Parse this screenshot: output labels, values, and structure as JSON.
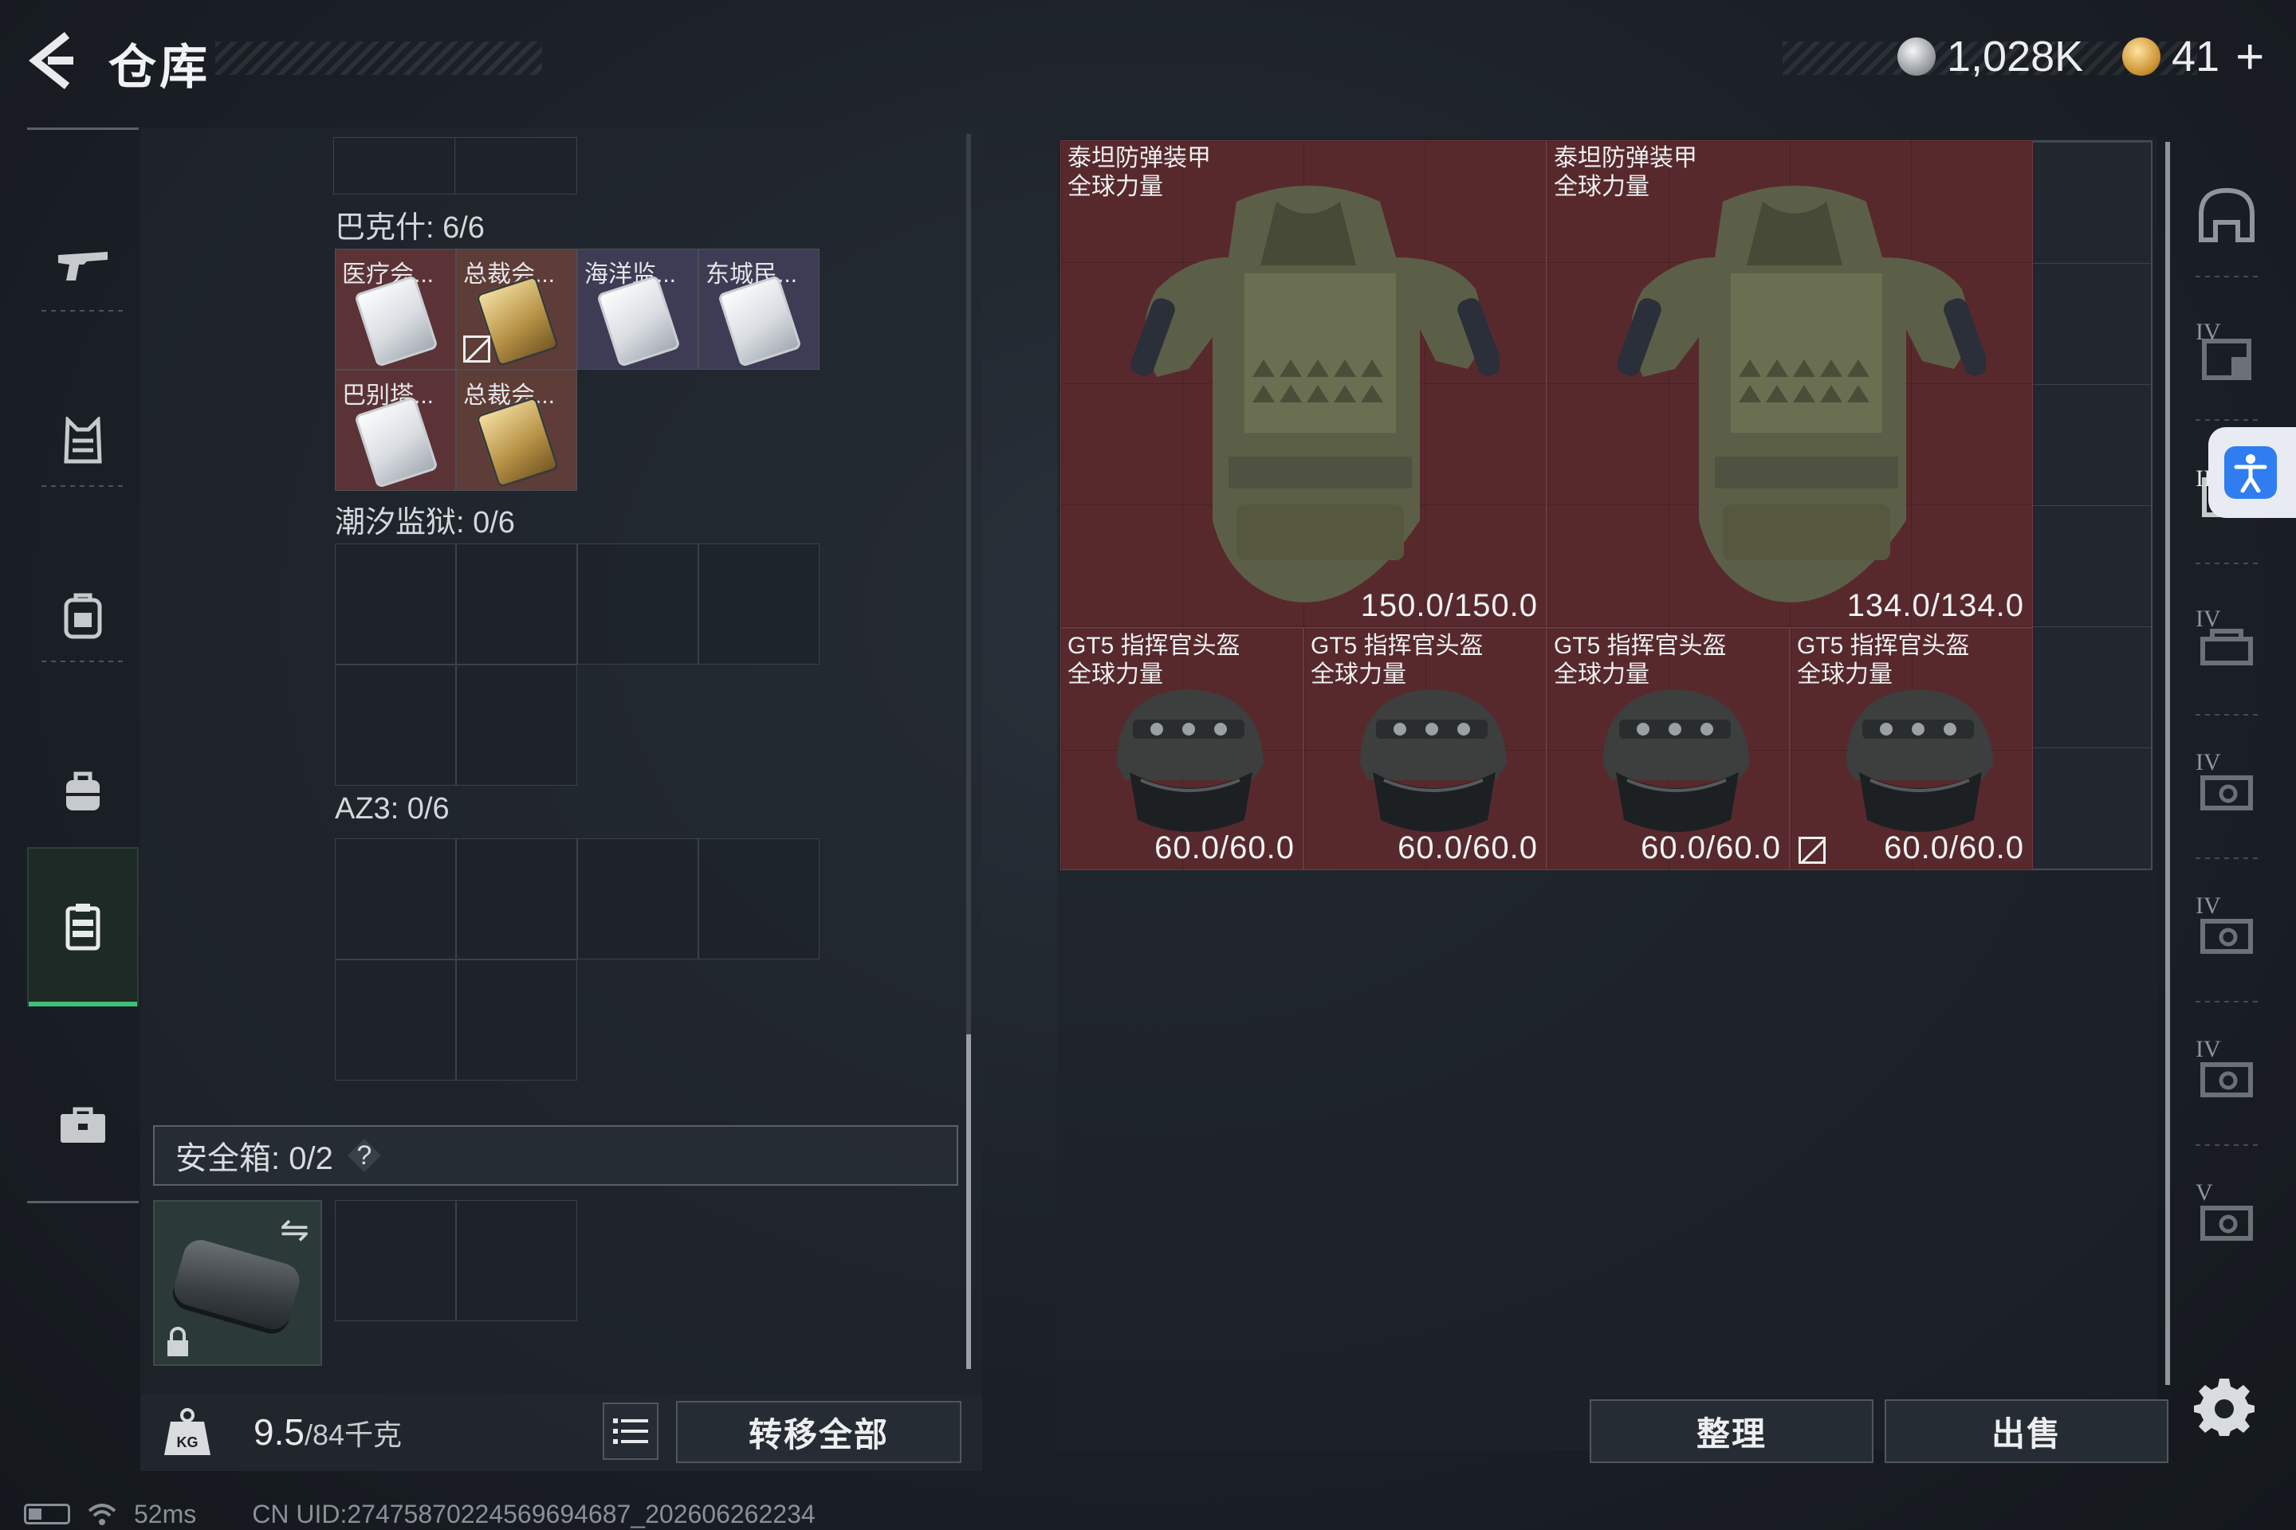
{
  "header": {
    "title": "仓库",
    "currency_silver": "1,028K",
    "currency_gold": "41",
    "currency_gold_plus": "+"
  },
  "left_rail": {
    "items": [
      {
        "name": "weapons",
        "icon": "gun-icon"
      },
      {
        "name": "armor",
        "icon": "vest-icon"
      },
      {
        "name": "backpack",
        "icon": "backpack-icon"
      },
      {
        "name": "chest-rig",
        "icon": "rig-icon"
      },
      {
        "name": "key-case",
        "icon": "keycard-case-icon",
        "active": true
      },
      {
        "name": "toolbox",
        "icon": "briefcase-icon"
      }
    ]
  },
  "storage": {
    "sections": [
      {
        "label": "巴克什: 6/6",
        "keys": [
          {
            "name": "医疗会...",
            "rarity": "white"
          },
          {
            "name": "总裁会...",
            "rarity": "gold",
            "unbindable": true
          },
          {
            "name": "海洋监...",
            "rarity": "white"
          },
          {
            "name": "东城民...",
            "rarity": "white"
          },
          {
            "name": "巴别塔...",
            "rarity": "white"
          },
          {
            "name": "总裁会...",
            "rarity": "gold"
          }
        ]
      },
      {
        "label": "潮汐监狱: 0/6"
      },
      {
        "label": "AZ3: 0/6"
      }
    ],
    "safe_box_label": "安全箱: 0/2",
    "safe_box_help": "?",
    "weight_value": "9.5",
    "weight_total": "/84千克",
    "transfer_all": "转移全部"
  },
  "inventory": {
    "items": [
      {
        "name_line1": "泰坦防弹装甲",
        "name_line2": "全球力量",
        "durability": "150.0/150.0",
        "type": "vest"
      },
      {
        "name_line1": "泰坦防弹装甲",
        "name_line2": "全球力量",
        "durability": "134.0/134.0",
        "type": "vest"
      },
      {
        "name_line1": "GT5 指挥官头盔",
        "name_line2": "全球力量",
        "durability": "60.0/60.0",
        "type": "helmet"
      },
      {
        "name_line1": "GT5 指挥官头盔",
        "name_line2": "全球力量",
        "durability": "60.0/60.0",
        "type": "helmet"
      },
      {
        "name_line1": "GT5 指挥官头盔",
        "name_line2": "全球力量",
        "durability": "60.0/60.0",
        "type": "helmet",
        "unbindable": true
      },
      {
        "name_line1": "GT5 指挥官头盔",
        "name_line2": "全球力量",
        "durability": "60.0/60.0",
        "type": "helmet"
      }
    ],
    "sort_label": "整理",
    "sell_label": "出售"
  },
  "right_rail": {
    "items": [
      {
        "icon": "helmet-slot-icon",
        "tier": ""
      },
      {
        "icon": "armor-slot-icon",
        "tier": "IV"
      },
      {
        "icon": "armor-slot-icon",
        "tier": "III"
      },
      {
        "icon": "rig-slot-icon",
        "tier": "IV"
      },
      {
        "icon": "bag-slot-icon",
        "tier": "IV"
      },
      {
        "icon": "bag-slot-icon",
        "tier": "IV"
      },
      {
        "icon": "bag-slot-icon",
        "tier": "IV"
      },
      {
        "icon": "bag-slot-icon",
        "tier": "V"
      }
    ]
  },
  "status_bar": {
    "ping": "52ms",
    "uid": "CN UID:2747587022456969468​7_202606262234"
  },
  "colors": {
    "accent_green": "#3fbf7a",
    "item_red": "#57292d",
    "accessibility_blue": "#2f7df0"
  }
}
